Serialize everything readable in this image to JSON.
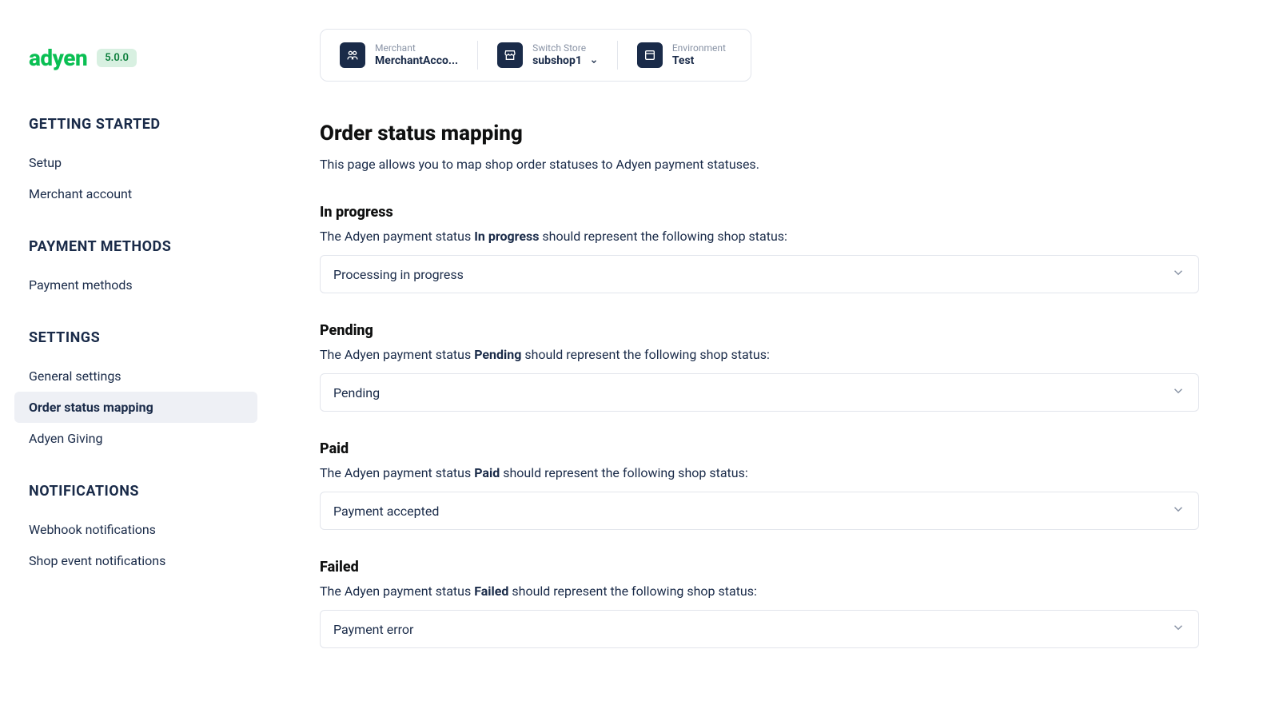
{
  "brand": {
    "name": "adyen",
    "version": "5.0.0"
  },
  "sidebar": {
    "sections": [
      {
        "heading": "GETTING STARTED",
        "items": [
          {
            "label": "Setup",
            "active": false
          },
          {
            "label": "Merchant account",
            "active": false
          }
        ]
      },
      {
        "heading": "PAYMENT METHODS",
        "items": [
          {
            "label": "Payment methods",
            "active": false
          }
        ]
      },
      {
        "heading": "SETTINGS",
        "items": [
          {
            "label": "General settings",
            "active": false
          },
          {
            "label": "Order status mapping",
            "active": true
          },
          {
            "label": "Adyen Giving",
            "active": false
          }
        ]
      },
      {
        "heading": "NOTIFICATIONS",
        "items": [
          {
            "label": "Webhook notifications",
            "active": false
          },
          {
            "label": "Shop event notifications",
            "active": false
          }
        ]
      }
    ]
  },
  "header": {
    "merchant": {
      "label": "Merchant",
      "value": "MerchantAcco..."
    },
    "store": {
      "label": "Switch Store",
      "value": "subshop1"
    },
    "environment": {
      "label": "Environment",
      "value": "Test"
    }
  },
  "page": {
    "title": "Order status mapping",
    "description": "This page allows you to map shop order statuses to Adyen payment statuses."
  },
  "mappings": [
    {
      "title": "In progress",
      "desc_prefix": "The Adyen payment status ",
      "desc_bold": "In progress",
      "desc_suffix": " should represent the following shop status:",
      "value": "Processing in progress"
    },
    {
      "title": "Pending",
      "desc_prefix": "The Adyen payment status ",
      "desc_bold": "Pending",
      "desc_suffix": " should represent the following shop status:",
      "value": "Pending"
    },
    {
      "title": "Paid",
      "desc_prefix": "The Adyen payment status ",
      "desc_bold": "Paid",
      "desc_suffix": " should represent the following shop status:",
      "value": "Payment accepted"
    },
    {
      "title": "Failed",
      "desc_prefix": "The Adyen payment status ",
      "desc_bold": "Failed",
      "desc_suffix": " should represent the following shop status:",
      "value": "Payment error"
    }
  ]
}
